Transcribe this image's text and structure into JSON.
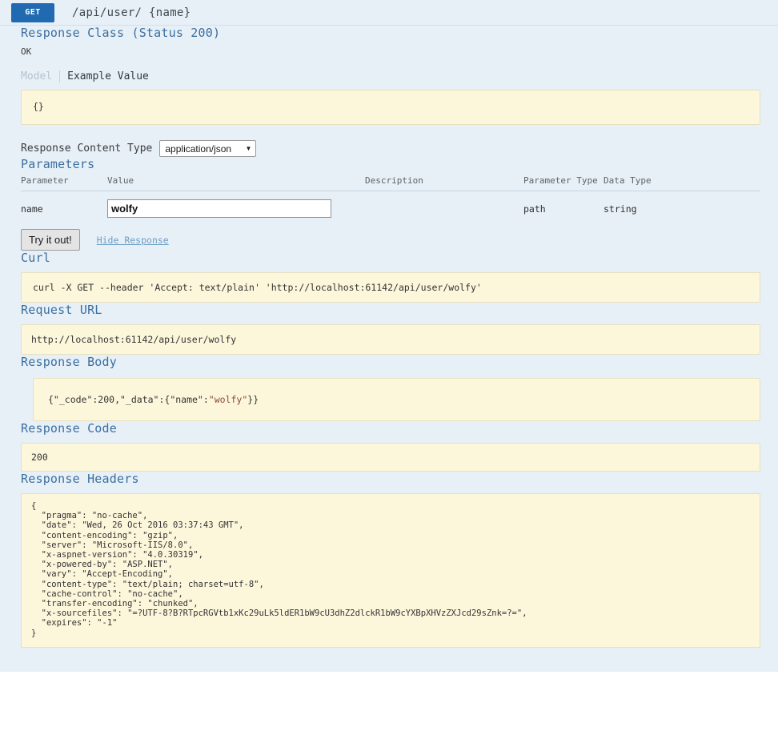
{
  "operation": {
    "method": "GET",
    "path": "/api/user/ {name}"
  },
  "response_class": {
    "title": "Response Class (Status 200)",
    "status_note": "OK",
    "tabs": [
      {
        "label": "Model",
        "active": false
      },
      {
        "label": "Example Value",
        "active": true
      }
    ],
    "example_value": "{}"
  },
  "content_type": {
    "label": "Response Content Type",
    "selected": "application/json",
    "caret": "▼"
  },
  "parameters": {
    "title": "Parameters",
    "columns": [
      "Parameter",
      "Value",
      "Description",
      "Parameter Type",
      "Data Type"
    ],
    "rows": [
      {
        "parameter": "name",
        "value": "wolfy",
        "placeholder": "",
        "description": "",
        "parameter_type": "path",
        "data_type": "string"
      }
    ]
  },
  "actions": {
    "try_it_out": "Try it out!",
    "hide_response": "Hide Response"
  },
  "curl": {
    "title": "Curl",
    "command": "curl -X GET --header 'Accept: text/plain' 'http://localhost:61142/api/user/wolfy'"
  },
  "request_url": {
    "title": "Request URL",
    "url": "http://localhost:61142/api/user/wolfy"
  },
  "response_body": {
    "title": "Response Body",
    "prefix": "{\"_code\":200,\"_data\":{\"name\":",
    "highlight": "\"wolfy\"",
    "suffix": "}}"
  },
  "response_code": {
    "title": "Response Code",
    "code": "200"
  },
  "response_headers": {
    "title": "Response Headers",
    "json": "{\n  \"pragma\": \"no-cache\",\n  \"date\": \"Wed, 26 Oct 2016 03:37:43 GMT\",\n  \"content-encoding\": \"gzip\",\n  \"server\": \"Microsoft-IIS/8.0\",\n  \"x-aspnet-version\": \"4.0.30319\",\n  \"x-powered-by\": \"ASP.NET\",\n  \"vary\": \"Accept-Encoding\",\n  \"content-type\": \"text/plain; charset=utf-8\",\n  \"cache-control\": \"no-cache\",\n  \"transfer-encoding\": \"chunked\",\n  \"x-sourcefiles\": \"=?UTF-8?B?RTpcRGVtb1xKc29uLk5ldER1bW9cU3dhZ2dlckR1bW9cYXBpXHVzZXJcd29sZnk=?=\",\n  \"expires\": \"-1\"\n}"
  },
  "colors": {
    "method_badge": "#1f6ab0",
    "page_background": "#e7f0f7",
    "code_box": "#fcf6db",
    "section_title": "#3b6e9f"
  }
}
